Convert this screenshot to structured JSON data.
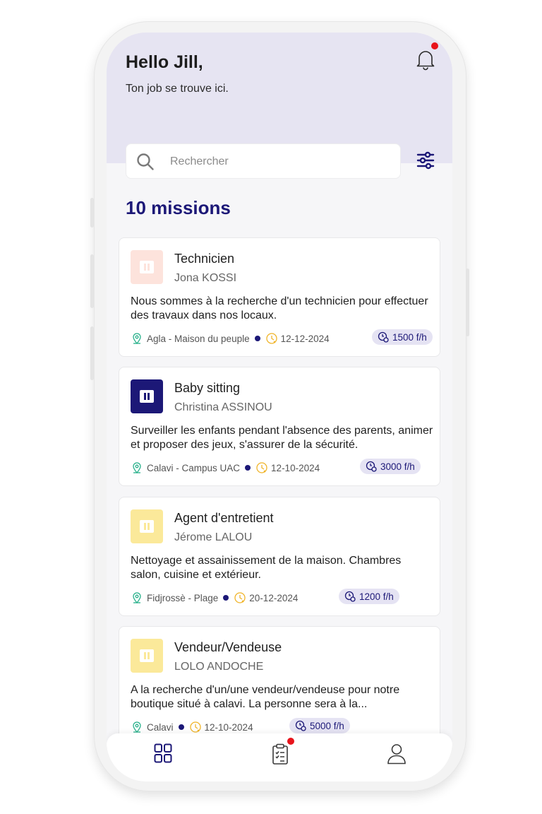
{
  "header": {
    "greeting": "Hello Jill,",
    "subtitle": "Ton job se trouve ici.",
    "notification_icon": "bell-icon"
  },
  "search": {
    "placeholder": "Rechercher",
    "value": "",
    "icon": "search-icon",
    "filter_icon": "sliders-icon"
  },
  "missions_count_label": "10 missions",
  "colors": {
    "brand": "#1c1877",
    "header_bg": "#e6e4f2",
    "notification": "#e8141c",
    "location": "#27b08a",
    "date": "#f0b429"
  },
  "missions": [
    {
      "title": "Technicien",
      "company": "Jona  KOSSI",
      "description": "Nous sommes à la recherche d'un technicien pour effectuer des travaux dans nos locaux.",
      "location": "Agla - Maison du peuple",
      "date": "12-12-2024",
      "rate": "1500 f/h",
      "logo_color": "#fde3dc"
    },
    {
      "title": "Baby sitting",
      "company": "Christina ASSINOU",
      "description": "Surveiller les enfants pendant l'absence des parents, animer et proposer des jeux, s'assurer de la sécurité.",
      "location": "Calavi - Campus UAC",
      "date": "12-10-2024",
      "rate": "3000 f/h",
      "logo_color": "#1c1877"
    },
    {
      "title": "Agent d'entretient",
      "company": "Jérome LALOU",
      "description": "Nettoyage et assainissement de la maison. Chambres salon, cuisine et extérieur.",
      "location": "Fidjrossè - Plage",
      "date": "20-12-2024",
      "rate": "1200 f/h",
      "logo_color": "#fbe99a"
    },
    {
      "title": "Vendeur/Vendeuse",
      "company": "LOLO ANDOCHE",
      "description": "A la recherche d'un/une vendeur/vendeuse pour notre boutique situé à calavi. La personne sera à la...",
      "location": "Calavi",
      "date": "12-10-2024",
      "rate": "5000 f/h",
      "logo_color": "#fbe99a"
    }
  ],
  "bottom_nav": {
    "items": [
      {
        "name": "dashboard",
        "icon": "grid-icon"
      },
      {
        "name": "missions",
        "icon": "clipboard-icon"
      },
      {
        "name": "profile",
        "icon": "user-icon"
      }
    ]
  }
}
